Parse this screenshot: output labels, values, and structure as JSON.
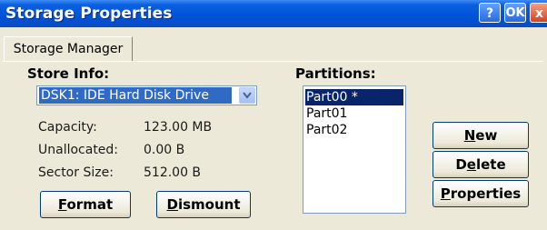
{
  "window": {
    "title": "Storage Properties",
    "help_label": "?",
    "ok_label": "OK",
    "close_label": "x"
  },
  "tab": {
    "label": "Storage Manager"
  },
  "store_info": {
    "heading": "Store Info:",
    "selected_store": "DSK1: IDE Hard Disk Drive",
    "capacity_label": "Capacity:",
    "capacity_value": "123.00 MB",
    "unallocated_label": "Unallocated:",
    "unallocated_value": "0.00 B",
    "sector_size_label": "Sector Size:",
    "sector_size_value": "512.00 B",
    "format_pre": "",
    "format_mnemonic": "F",
    "format_post": "ormat",
    "dismount_pre": "",
    "dismount_mnemonic": "D",
    "dismount_post": "ismount"
  },
  "partitions": {
    "heading": "Partitions:",
    "items": [
      "Part00 *",
      "Part01",
      "Part02"
    ],
    "selected_index": 0
  },
  "actions": {
    "new_pre": "",
    "new_mnemonic": "N",
    "new_post": "ew",
    "delete_pre": "D",
    "delete_mnemonic": "e",
    "delete_post": "lete",
    "properties_pre": "",
    "properties_mnemonic": "P",
    "properties_post": "roperties"
  },
  "colors": {
    "titlebar": "#0053d6",
    "window_bg": "#ece9d8",
    "selection": "#0a246a"
  }
}
